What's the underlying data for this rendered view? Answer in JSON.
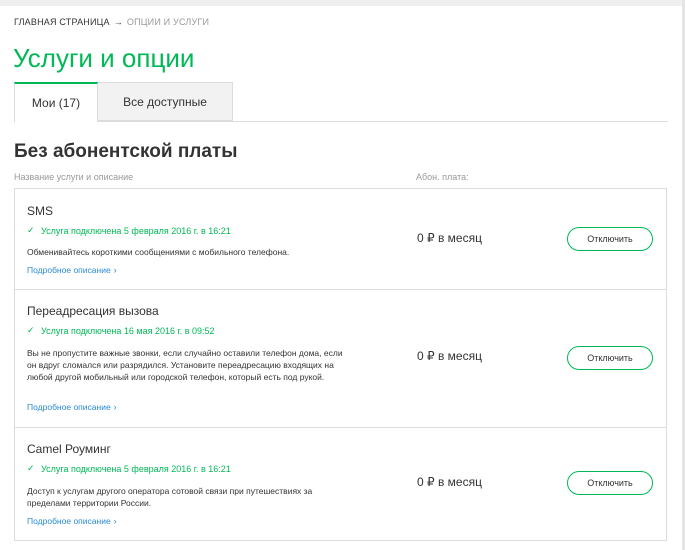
{
  "breadcrumb": {
    "home": "ГЛАВНАЯ СТРАНИЦА",
    "separator": "→",
    "current": "ОПЦИИ И УСЛУГИ"
  },
  "page_title": "Услуги и опции",
  "tabs": [
    {
      "label": "Мои (17)",
      "active": true
    },
    {
      "label": "Все доступные",
      "active": false
    }
  ],
  "section_title": "Без абонентской платы",
  "columns": {
    "name": "Название услуги и описание",
    "fee": "Абон. плата:"
  },
  "accent_color": "#00b956",
  "link_color": "#2a8bd6",
  "services": [
    {
      "name": "SMS",
      "status": "Услуга подключена 5 февраля 2016 г. в 16:21",
      "description": "Обменивайтесь короткими сообщениями с мобильного телефона.",
      "link": "Подробное описание",
      "price": "0 ₽ в месяц",
      "button": "Отключить"
    },
    {
      "name": "Переадресация вызова",
      "status": "Услуга подключена 16 мая 2016 г. в 09:52",
      "description": "Вы не пропустите важные звонки, если случайно оставили телефон дома, если он вдруг сломался или разрядился. Установите переадресацию входящих на любой другой мобильный или городской телефон, который есть под рукой.",
      "link": "Подробное описание",
      "price": "0 ₽ в месяц",
      "button": "Отключить"
    },
    {
      "name": "Camel Роуминг",
      "status": "Услуга подключена 5 февраля 2016 г. в 16:21",
      "description": "Доступ к услугам другого оператора сотовой связи при путешествиях за пределами территории России.",
      "link": "Подробное описание",
      "price": "0 ₽ в месяц",
      "button": "Отключить"
    }
  ],
  "icons": {
    "status": "check-icon",
    "link": "chevron-right-icon"
  }
}
